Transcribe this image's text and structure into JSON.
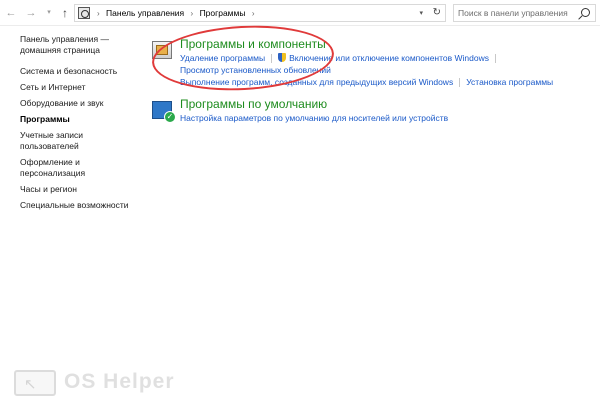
{
  "address_bar": {
    "back_glyph": "←",
    "forward_glyph": "→",
    "history_glyph": "▾",
    "up_glyph": "↑",
    "crumbs": [
      "Панель управления",
      "Программы"
    ],
    "crumb_separator": "›",
    "dropdown_glyph": "▾",
    "refresh_glyph": "↻"
  },
  "search": {
    "placeholder": "Поиск в панели управления"
  },
  "sidebar": {
    "items": [
      "Панель управления — домашняя страница",
      "Система и безопасность",
      "Сеть и Интернет",
      "Оборудование и звук",
      "Программы",
      "Учетные записи пользователей",
      "Оформление и персонализация",
      "Часы и регион",
      "Специальные возможности"
    ],
    "active_index": 4
  },
  "main": {
    "groups": [
      {
        "title": "Программы и компоненты",
        "icon": "programs-features-icon",
        "links": [
          "Удаление программы",
          "Включение или отключение компонентов Windows",
          "Просмотр установленных обновлений",
          "Выполнение программ, созданных для предыдущих версий Windows",
          "Установка программы"
        ]
      },
      {
        "title": "Программы по умолчанию",
        "icon": "default-programs-icon",
        "links": [
          "Настройка параметров по умолчанию для носителей или устройств"
        ]
      }
    ]
  },
  "watermark": {
    "text": "OS Helper"
  },
  "colors": {
    "link": "#1a59c8",
    "group_title": "#1e8c1e",
    "highlight": "#e03a3a"
  }
}
